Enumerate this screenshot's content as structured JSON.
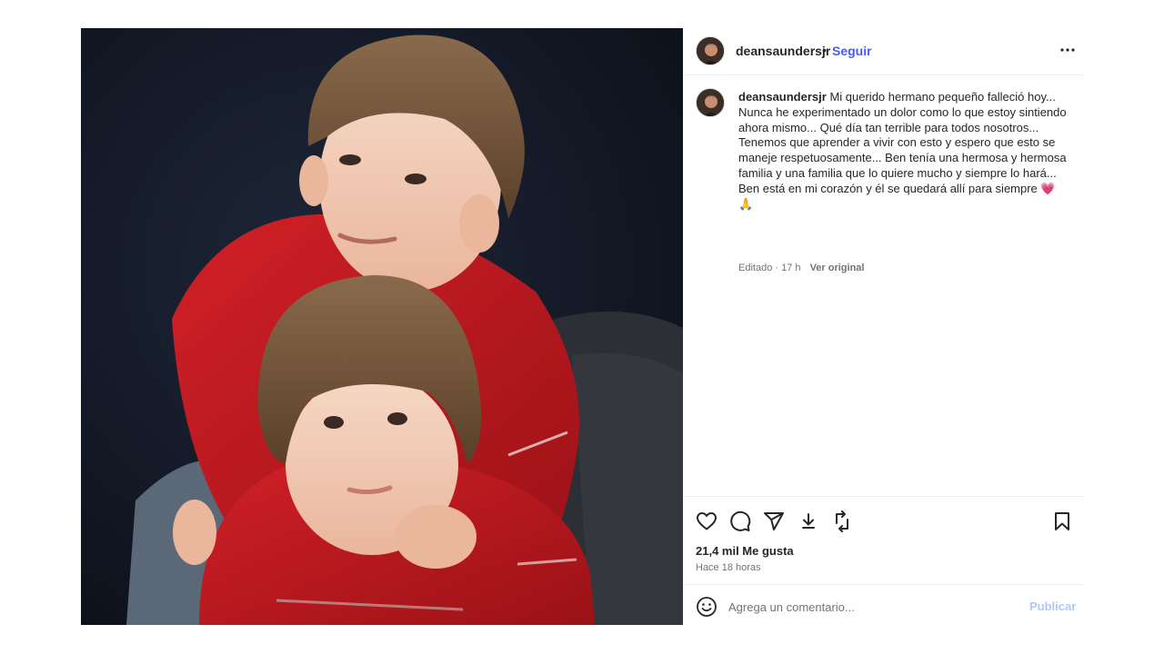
{
  "post": {
    "username": "deansaundersjr",
    "follow_label": "Seguir",
    "separator": "•",
    "caption": "Mi querido hermano pequeño falleció hoy... Nunca he experimentado un dolor como lo que estoy sintiendo ahora mismo... Qué día tan terrible para todos nosotros... Tenemos que aprender a vivir con esto y espero que esto se maneje respetuosamente... Ben tenía una hermosa y hermosa familia y una familia que lo quiere mucho y siempre lo hará... Ben está en mi corazón y él se quedará allí para siempre",
    "caption_emojis": "💗 🙏",
    "edited_label": "Editado · 17 h",
    "see_original_label": "Ver original",
    "likes": "21,4 mil Me gusta",
    "time_ago": "Hace 18 horas",
    "comment_placeholder": "Agrega un comentario...",
    "publish_label": "Publicar"
  },
  "icons": {
    "more": "more-options-icon",
    "like": "heart-icon",
    "comment": "comment-icon",
    "share": "send-icon",
    "download": "download-icon",
    "repost": "repost-icon",
    "save": "bookmark-icon",
    "emoji": "emoji-icon"
  },
  "colors": {
    "accent": "#4a5df9",
    "publish_disabled": "#b3c6fb",
    "secondary_text": "#737373",
    "sweater_red": "#c2191f"
  }
}
